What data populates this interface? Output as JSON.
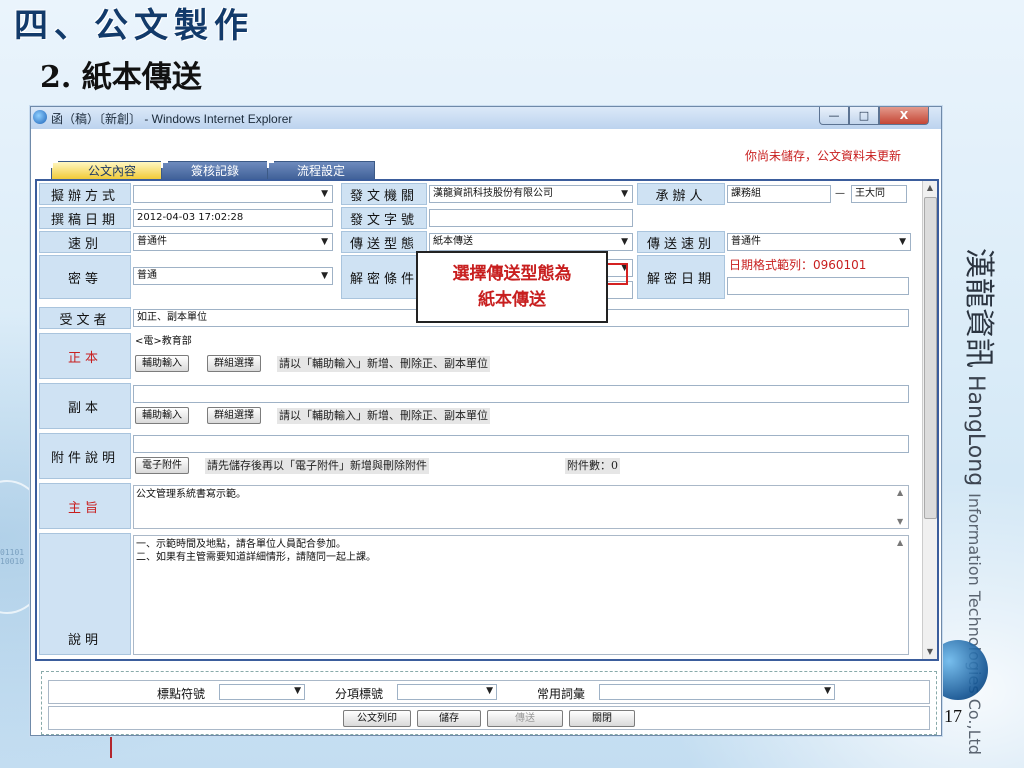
{
  "slide": {
    "title": "四、公文製作",
    "subtitle": "2. 紙本傳送",
    "page_number": "17",
    "brand_cn": "漢龍資訊",
    "brand_en_1": "HangLong",
    "brand_en_2": "Information Technologies Co.,Ltd"
  },
  "window": {
    "title": "函（稿）〔新創〕 - Windows Internet Explorer",
    "controls": {
      "minimize": "—",
      "maximize": "□",
      "close": "X"
    }
  },
  "tabs": [
    {
      "label": "公文內容",
      "active": true
    },
    {
      "label": "簽核記錄",
      "active": false
    },
    {
      "label": "流程設定",
      "active": false
    }
  ],
  "unsaved_notice": "你尚未儲存，公文資料未更新",
  "form": {
    "drafting_method": {
      "label": "擬辦方式",
      "value": ""
    },
    "issuing_agency": {
      "label": "發文機關",
      "value": "漢龍資訊科技股份有限公司"
    },
    "handler": {
      "label": "承辦人",
      "unit": "課務組",
      "name": "王大同"
    },
    "draft_date": {
      "label": "撰稿日期",
      "value": "2012-04-03 17:02:28"
    },
    "doc_number": {
      "label": "發文字號",
      "value": ""
    },
    "speed": {
      "label": "速別",
      "value": "普通件"
    },
    "transmission_type": {
      "label": "傳送型態",
      "value": "紙本傳送"
    },
    "transmission_speed": {
      "label": "傳送速別",
      "value": "普通件"
    },
    "security_level": {
      "label": "密等",
      "value": "普通"
    },
    "declass_condition": {
      "label": "解密條件"
    },
    "declass_date": {
      "label": "解密日期",
      "format_hint": "日期格式範列：0960101",
      "value": ""
    },
    "recipient": {
      "label": "受文者",
      "value": "如正、副本單位"
    },
    "original": {
      "label": "正本",
      "value": "<電>教育部"
    },
    "copy": {
      "label": "副本",
      "value": ""
    },
    "attachment": {
      "label": "附件說明",
      "value": "",
      "button": "電子附件",
      "hint": "請先儲存後再以「電子附件」新增與刪除附件",
      "count_label": "附件數：0"
    },
    "subject": {
      "label": "主旨",
      "value": "公文管理系統書寫示範。"
    },
    "description": {
      "label": "說明",
      "line1": "一、示範時間及地點，請各單位人員配合參加。",
      "line2": "二、如果有主管需要知道詳細情形，請隨同一起上課。"
    },
    "assist_input_button": "輔助輸入",
    "group_select_button": "群組選擇",
    "unit_hint": "請以「輔助輸入」新增、刪除正、副本單位"
  },
  "callout": {
    "line1": "選擇傳送型態為",
    "line2": "紙本傳送"
  },
  "toolbar": {
    "punctuation_label": "標點符號",
    "section_label": "分項標號",
    "phrases_label": "常用詞彙",
    "print_button": "公文列印",
    "save_button": "儲存",
    "send_button": "傳送",
    "close_button": "關閉"
  }
}
